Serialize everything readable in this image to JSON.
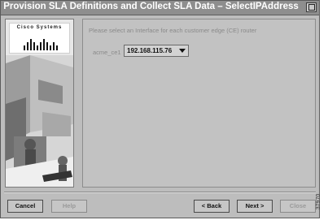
{
  "window": {
    "title": "Provision SLA Definitions and Collect SLA Data – SelectIPAddress"
  },
  "logo": {
    "text": "Cisco Systems"
  },
  "main": {
    "instruction": "Please select an Interface for each customer edge (CE) router",
    "ce_label": "acme_ce1",
    "ip_value": "192.168.115.76"
  },
  "buttons": {
    "cancel": "Cancel",
    "help": "Help",
    "back": "< Back",
    "next": "Next >",
    "close": "Close"
  },
  "figure_number": "37970"
}
